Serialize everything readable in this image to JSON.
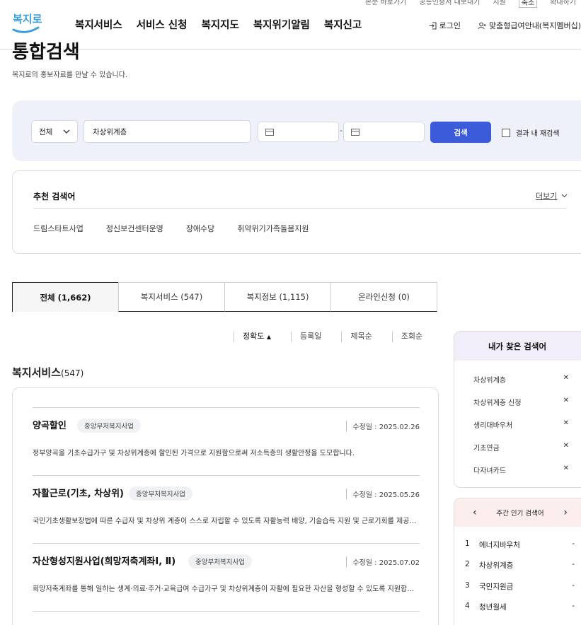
{
  "header": {
    "util": [
      "본문 바로가기",
      "공통인증서 내보내기",
      "지원",
      "축소",
      "확대하기"
    ],
    "logo_text": "복지로",
    "gnb": [
      "복지서비스",
      "서비스 신청",
      "복지지도",
      "복지위기알림",
      "복지신고"
    ],
    "login": "로그인",
    "guide": "맞춤형급여안내(복지멤버십)"
  },
  "page": {
    "title": "통합검색",
    "subtitle": "복지로의 홍보자료를 만날 수 있습니다."
  },
  "search": {
    "category": "전체",
    "keyword": "차상위계층",
    "date_sep": "-",
    "button": "검색",
    "recheck_label": "결과 내 재검색"
  },
  "recommended": {
    "title": "추천 검색어",
    "more": "더보기",
    "tags": [
      "드림스타트사업",
      "정신보건센터운영",
      "장애수당",
      "취약위기가족돌봄지원"
    ]
  },
  "tabs": [
    "전체 (1,662)",
    "복지서비스 (547)",
    "복지정보 (1,115)",
    "온라인신청 (0)"
  ],
  "sort": [
    "정확도",
    "등록일",
    "제목순",
    "조회순"
  ],
  "section": {
    "title": "복지서비스",
    "count": "(547)"
  },
  "results": [
    {
      "name": "양곡할인",
      "badge": "중앙부처복지사업",
      "date": "수정일 : 2025.02.26",
      "desc": "정부양곡을 기초수급가구 및 차상위계층에 할인된 가격으로 지원함으로써 저소득층의 생활안정을 도모합니다."
    },
    {
      "name": "자활근로(기초, 차상위)",
      "badge": "중앙부처복지사업",
      "date": "수정일 : 2025.05.26",
      "desc": "국민기초생활보장법에 따른 수급자 및 차상위 계층이 스스로 자립할 수 있도록 자활능력 배양, 기술습득 지원 및 근로기회를 제공합니다."
    },
    {
      "name": "자산형성지원사업(희망저축계좌Ⅰ, Ⅱ)",
      "badge": "중앙부처복지사업",
      "date": "수정일 : 2025.07.02",
      "desc": "희망저축계좌를 통해 일하는 생계·의료·주거·교육급여 수급가구 및 차상위계층이 자활에 필요한 자산을 형성할 수 있도록 지원합니다."
    }
  ],
  "my_searches": {
    "title": "내가 찾은 검색어",
    "items": [
      "차상위계층",
      "차상위계층 신청",
      "생리대바우처",
      "기초연금",
      "다자녀카드"
    ]
  },
  "popular": {
    "title": "주간 인기 검색어",
    "items": [
      {
        "rank": "1",
        "term": "에너지바우처",
        "change": "-"
      },
      {
        "rank": "2",
        "term": "차상위계층",
        "change": "-"
      },
      {
        "rank": "3",
        "term": "국민지원금",
        "change": "-"
      },
      {
        "rank": "4",
        "term": "청년월세",
        "change": "-"
      }
    ]
  },
  "colors": {
    "primary": "#3b5bdb",
    "search_bg": "#eef1f9",
    "logo": "#3aa0dc"
  }
}
